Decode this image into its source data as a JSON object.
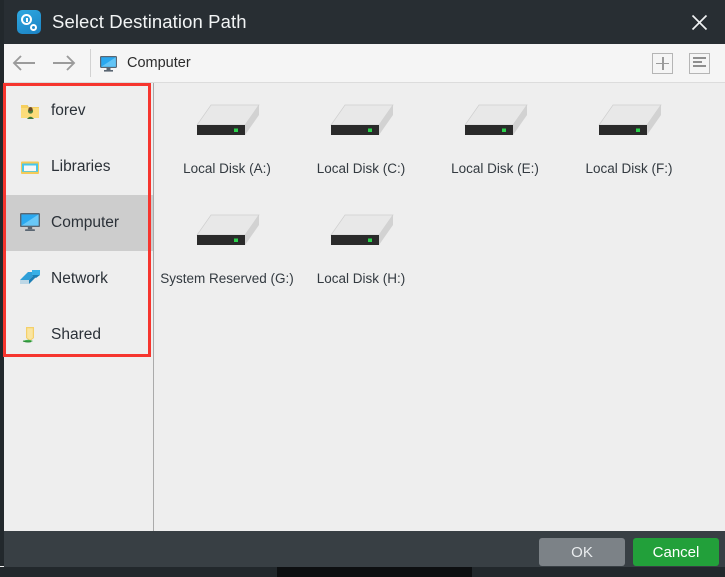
{
  "window": {
    "title": "Select Destination Path",
    "app_icon": "clock-gear-icon",
    "close_icon": "close-icon"
  },
  "toolbar": {
    "back_icon": "arrow-left-icon",
    "forward_icon": "arrow-right-icon",
    "breadcrumb_icon": "computer-monitor-icon",
    "breadcrumb_label": "Computer",
    "new_folder_icon": "plus-icon",
    "view_mode_icon": "list-view-icon"
  },
  "sidebar": {
    "items": [
      {
        "label": "forev",
        "icon": "user-folder-icon",
        "selected": false
      },
      {
        "label": "Libraries",
        "icon": "libraries-folder-icon",
        "selected": false
      },
      {
        "label": "Computer",
        "icon": "computer-monitor-icon",
        "selected": true
      },
      {
        "label": "Network",
        "icon": "network-icon",
        "selected": false
      },
      {
        "label": "Shared",
        "icon": "shared-folder-icon",
        "selected": false
      }
    ]
  },
  "files": {
    "items": [
      {
        "label": "Local Disk (A:)",
        "icon": "hard-drive-icon"
      },
      {
        "label": "Local Disk (C:)",
        "icon": "hard-drive-icon"
      },
      {
        "label": "Local Disk (E:)",
        "icon": "hard-drive-icon"
      },
      {
        "label": "Local Disk (F:)",
        "icon": "hard-drive-icon"
      },
      {
        "label": "System Reserved (G:)",
        "icon": "hard-drive-icon"
      },
      {
        "label": "Local Disk (H:)",
        "icon": "hard-drive-icon"
      }
    ]
  },
  "footer": {
    "ok_label": "OK",
    "cancel_label": "Cancel"
  },
  "colors": {
    "titlebar": "#282e33",
    "footer": "#383f44",
    "accent_green": "#22a03a",
    "ok_disabled": "#7c8287",
    "highlight_box": "#f6352e",
    "selected_row": "#cdcdcd"
  }
}
